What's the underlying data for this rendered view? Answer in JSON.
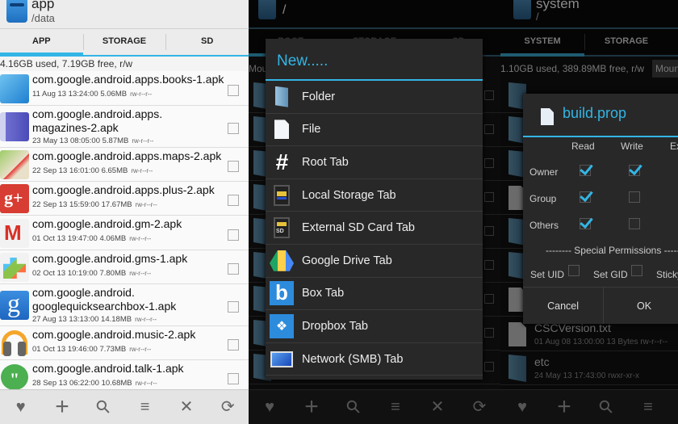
{
  "panel_left": {
    "header": {
      "title": "app",
      "path": "/data"
    },
    "tabs": [
      {
        "label": "APP",
        "active": true
      },
      {
        "label": "STORAGE",
        "active": false
      },
      {
        "label": "SD",
        "active": false
      }
    ],
    "usage": "4.16GB used, 7.19GB free, r/w",
    "files": [
      {
        "name": "com.google.android.apps.books-1.apk",
        "date": "11 Aug 13 13:24:00",
        "size": "5.06MB",
        "perm": "rw-r--r--",
        "icon": "books-icon"
      },
      {
        "name": "com.google.android.apps.\nmagazines-2.apk",
        "date": "23 May 13 08:05:00",
        "size": "5.87MB",
        "perm": "rw-r--r--",
        "icon": "magazines-icon"
      },
      {
        "name": "com.google.android.apps.maps-2.apk",
        "date": "22 Sep 13 16:01:00",
        "size": "6.65MB",
        "perm": "rw-r--r--",
        "icon": "maps-icon"
      },
      {
        "name": "com.google.android.apps.plus-2.apk",
        "date": "22 Sep 13 15:59:00",
        "size": "17.67MB",
        "perm": "rw-r--r--",
        "icon": "google-plus-icon"
      },
      {
        "name": "com.google.android.gm-2.apk",
        "date": "01 Oct 13 19:47:00",
        "size": "4.06MB",
        "perm": "rw-r--r--",
        "icon": "gmail-icon"
      },
      {
        "name": "com.google.android.gms-1.apk",
        "date": "02 Oct 13 10:19:00",
        "size": "7.80MB",
        "perm": "rw-r--r--",
        "icon": "play-services-icon"
      },
      {
        "name": "com.google.android.\ngooglequicksearchbox-1.apk",
        "date": "27 Aug 13 13:13:00",
        "size": "14.18MB",
        "perm": "rw-r--r--",
        "icon": "google-search-icon"
      },
      {
        "name": "com.google.android.music-2.apk",
        "date": "01 Oct 13 19:46:00",
        "size": "7.73MB",
        "perm": "rw-r--r--",
        "icon": "music-icon"
      },
      {
        "name": "com.google.android.talk-1.apk",
        "date": "28 Sep 13 06:22:00",
        "size": "10.68MB",
        "perm": "rw-r--r--",
        "icon": "hangouts-icon"
      }
    ],
    "toolbar": [
      {
        "icon": "heart-icon",
        "glyph": "♥"
      },
      {
        "icon": "plus-icon",
        "glyph": "+"
      },
      {
        "icon": "search-icon",
        "glyph": "⚲"
      },
      {
        "icon": "sort-icon",
        "glyph": "≡"
      },
      {
        "icon": "close-icon",
        "glyph": "✕"
      },
      {
        "icon": "refresh-icon",
        "glyph": "⟳"
      }
    ]
  },
  "panel_middle": {
    "header": {
      "path": "/"
    },
    "tabs": [
      {
        "label": "ROOT"
      },
      {
        "label": "STORAGE"
      },
      {
        "label": "SD"
      }
    ],
    "mount_label": "Mou",
    "dialog": {
      "title": "New.....",
      "items": [
        {
          "label": "Folder",
          "icon": "folder-icon"
        },
        {
          "label": "File",
          "icon": "file-icon"
        },
        {
          "label": "Root Tab",
          "icon": "hash-icon"
        },
        {
          "label": "Local Storage Tab",
          "icon": "local-storage-icon"
        },
        {
          "label": "External SD Card Tab",
          "icon": "sd-card-icon",
          "badge": "SD"
        },
        {
          "label": "Google Drive Tab",
          "icon": "google-drive-icon"
        },
        {
          "label": "Box Tab",
          "icon": "box-icon",
          "glyph": "b"
        },
        {
          "label": "Dropbox Tab",
          "icon": "dropbox-icon"
        },
        {
          "label": "Network (SMB) Tab",
          "icon": "network-icon"
        }
      ]
    }
  },
  "panel_right": {
    "header": {
      "title": "system",
      "path": "/"
    },
    "tabs": [
      {
        "label": "SYSTEM",
        "active": true
      },
      {
        "label": "STORAGE",
        "active": false
      }
    ],
    "usage": "1.10GB used, 389.89MB free, r/w",
    "mount_button": "Mount",
    "files": [
      {
        "name": "CSCVersion.txt",
        "meta": "01 Aug 08 13:00:00  13 Bytes  rw-r--r--"
      },
      {
        "name": "etc",
        "meta": "24 May 13 17:43:00    rwxr-xr-x"
      }
    ],
    "dialog": {
      "file_name": "build.prop",
      "columns": [
        "Read",
        "Write",
        "Exec"
      ],
      "rows": [
        {
          "label": "Owner",
          "read": true,
          "write": true,
          "exec": false
        },
        {
          "label": "Group",
          "read": true,
          "write": false,
          "exec": false
        },
        {
          "label": "Others",
          "read": true,
          "write": false,
          "exec": false
        }
      ],
      "special_header": "-------- Special Permissions --------",
      "special": [
        {
          "label": "Set UID",
          "checked": false
        },
        {
          "label": "Set GID",
          "checked": false
        },
        {
          "label": "Sticky",
          "checked": false
        }
      ],
      "cancel_label": "Cancel",
      "ok_label": "OK"
    }
  }
}
